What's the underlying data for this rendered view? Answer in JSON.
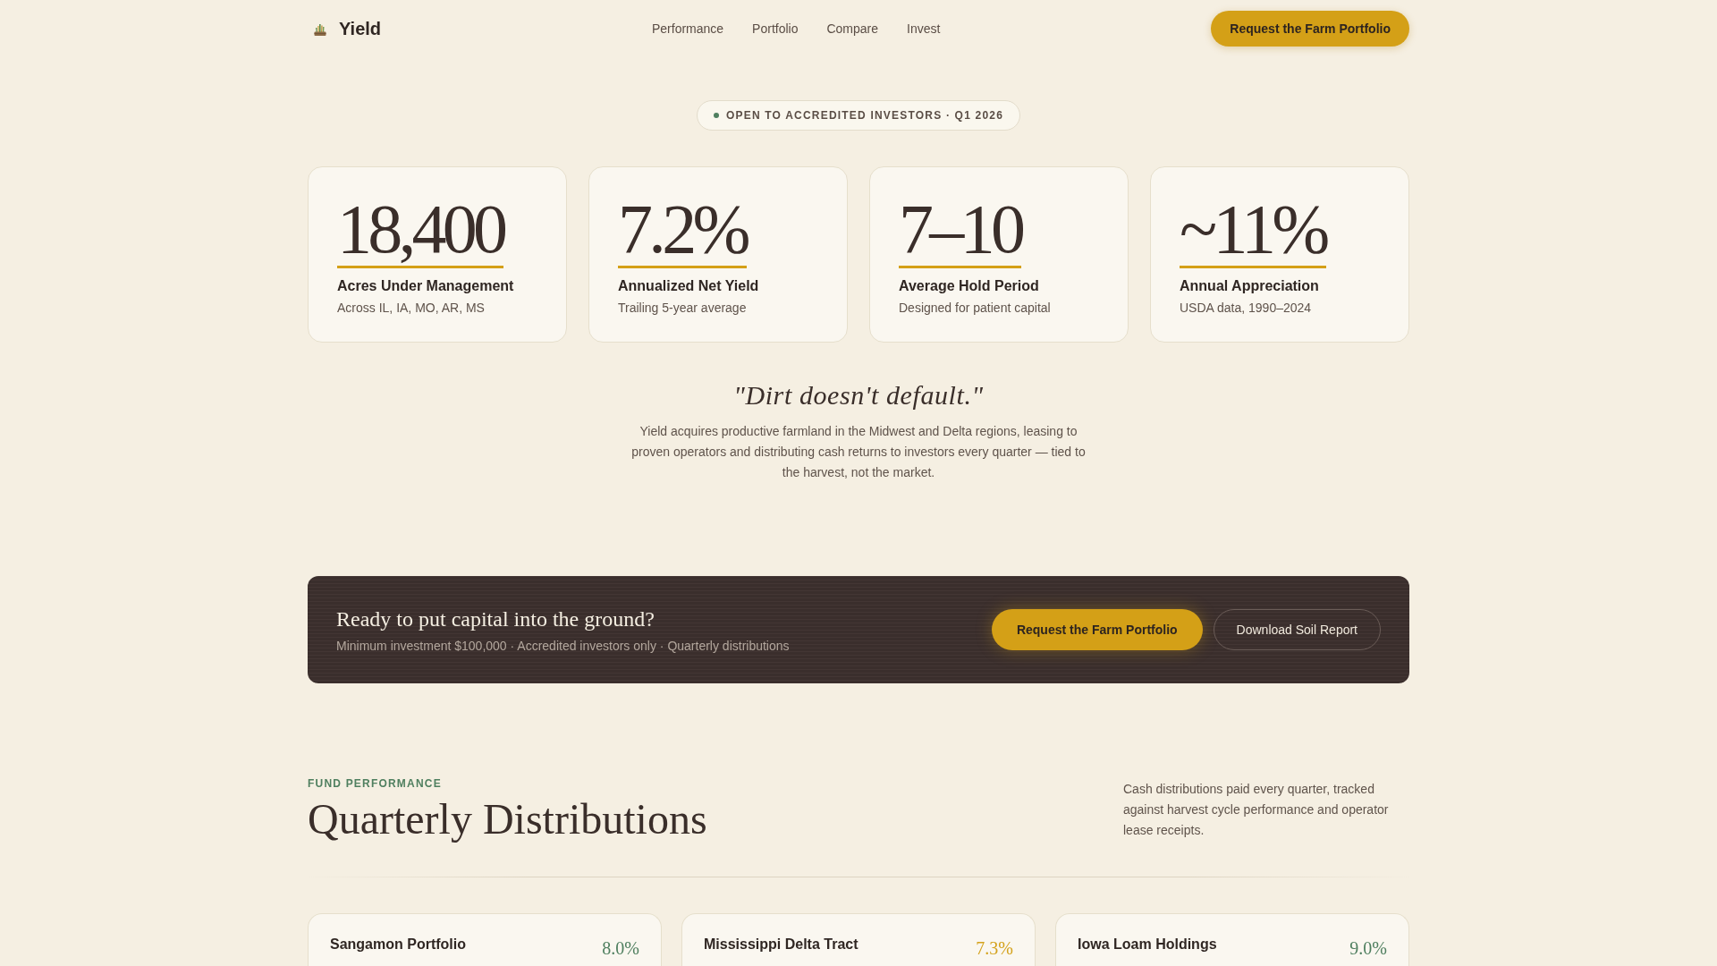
{
  "nav": {
    "brand": "Yield",
    "links": [
      "Performance",
      "Portfolio",
      "Compare",
      "Invest"
    ],
    "cta": "Request the Farm Portfolio"
  },
  "badge": "OPEN TO ACCREDITED INVESTORS · Q1 2026",
  "stats": [
    {
      "value": "18,400",
      "label": "Acres Under Management",
      "note": "Across IL, IA, MO, AR, MS"
    },
    {
      "value": "7.2%",
      "label": "Annualized Net Yield",
      "note": "Trailing 5-year average"
    },
    {
      "value": "7–10",
      "label": "Average Hold Period",
      "note": "Designed for patient capital"
    },
    {
      "value": "~11%",
      "label": "Annual Appreciation",
      "note": "USDA data, 1990–2024"
    }
  ],
  "quote": "\"Dirt doesn't default.\"",
  "intro": "Yield acquires productive farmland in the Midwest and Delta regions, leasing to proven operators and distributing cash returns to investors every quarter — tied to the harvest, not the market.",
  "cta_banner": {
    "title": "Ready to put capital into the ground?",
    "subtitle": "Minimum investment $100,000 · Accredited investors only · Quarterly distributions",
    "buttons": [
      {
        "label": "Request the Farm Portfolio",
        "kind": "primary"
      },
      {
        "label": "Download Soil Report",
        "kind": "outline"
      }
    ]
  },
  "performance": {
    "eyebrow": "FUND PERFORMANCE",
    "title": "Quarterly Distributions",
    "description": "Cash distributions paid every quarter, tracked against harvest cycle performance and operator lease receipts.",
    "funds": [
      {
        "name": "Sangamon Portfolio",
        "yield": "8.0%",
        "color": "#4f7f5f"
      },
      {
        "name": "Mississippi Delta Tract",
        "yield": "7.3%",
        "color": "#d4a21c"
      },
      {
        "name": "Iowa Loam Holdings",
        "yield": "9.0%",
        "color": "#4f7f5f"
      }
    ]
  }
}
